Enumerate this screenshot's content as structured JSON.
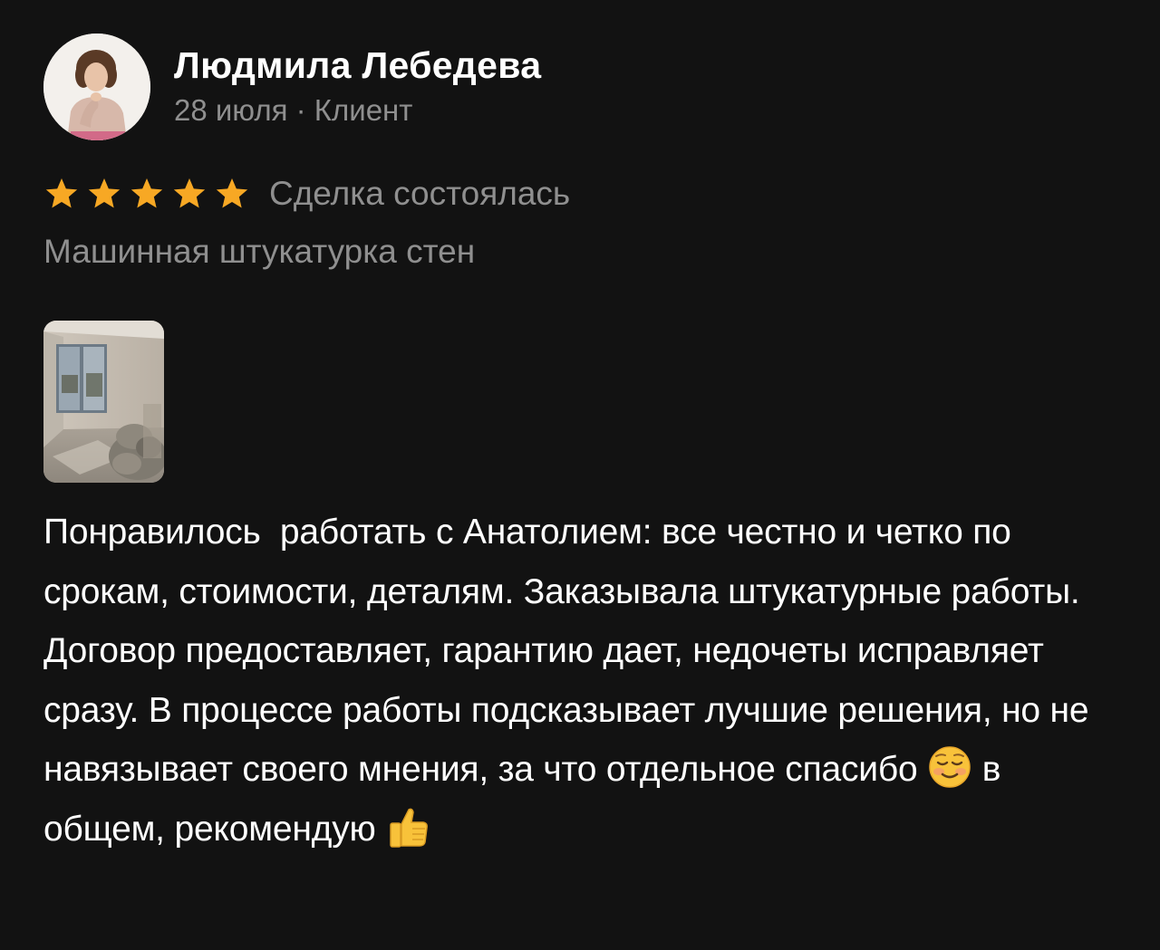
{
  "review": {
    "author_name": "Людмила Лебедева",
    "date": "28 июля",
    "meta_separator": " · ",
    "role": "Клиент",
    "rating": 5,
    "rating_max": 5,
    "star_color": "#f7a824",
    "deal_status": "Сделка состоялась",
    "service": "Машинная штукатурка стен",
    "text_part1": "Понравилось  работать с Анатолием: все честно и четко по срокам, стоимости, деталям. Заказывала штукатурные работы. Договор предоставляет, гарантию дает, недочеты исправляет сразу. В процессе работы подсказывает лучшие решения, но не навязывает своего мнения, за что отдельное спасибо ",
    "emoji1": "smiling-face-icon",
    "text_part2": " в общем, рекомендую ",
    "emoji2": "thumbs-up-icon"
  }
}
